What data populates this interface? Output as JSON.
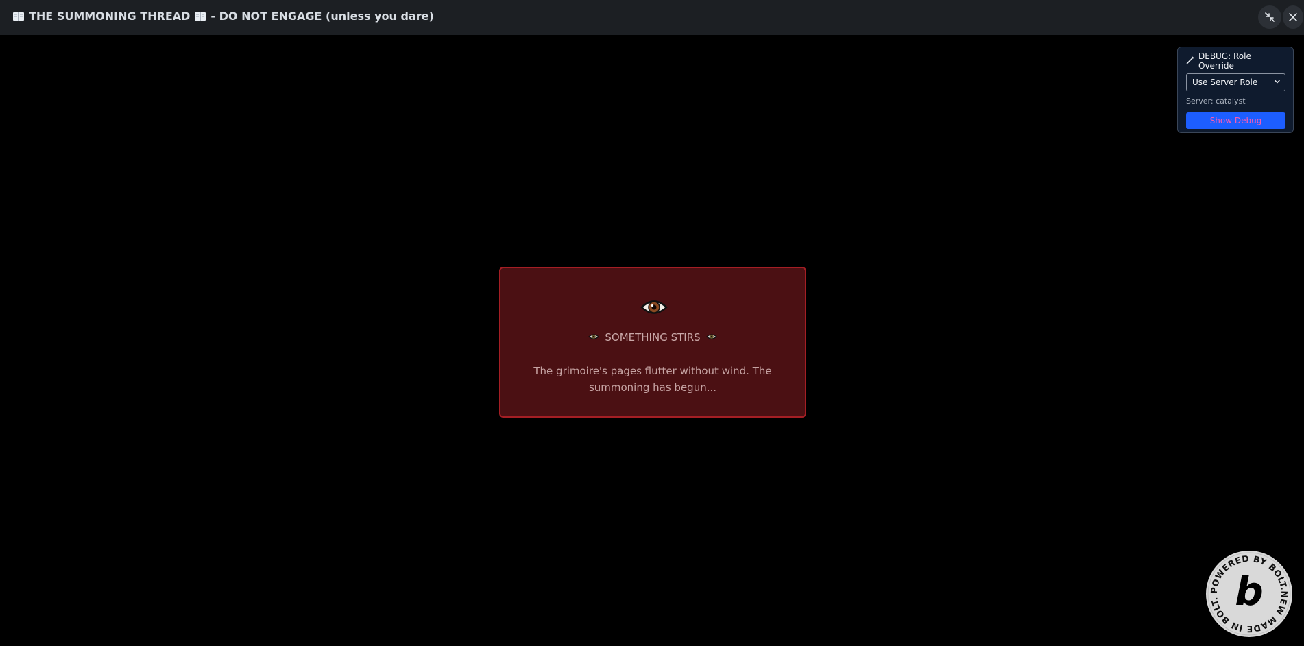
{
  "window": {
    "title_part1": "THE SUMMONING THREAD",
    "title_part2": "- DO NOT ENGAGE (unless you dare)",
    "title_icon": "book-icon",
    "minimize_icon": "minimize-arrows-icon",
    "close_icon": "close-icon"
  },
  "debug": {
    "header": "DEBUG: Role Override",
    "header_icon": "wand-icon",
    "select_value": "Use Server Role",
    "server_text": "Server: catalyst",
    "button_label": "Show Debug"
  },
  "card": {
    "icon": "eye-icon",
    "heading": "SOMETHING STIRS",
    "body": "The grimoire's pages flutter without wind. The summoning has begun..."
  },
  "badge": {
    "text": "POWERED BY BOLT.NEW MADE IN BOLT.NEW",
    "letter": "b"
  },
  "colors": {
    "background": "#000000",
    "titlebar": "#1c1f23",
    "card_bg": "#4b1013",
    "card_border": "#a41e24",
    "debug_bg": "#0f1b2e",
    "debug_button": "#1d5eff",
    "debug_button_text": "#ff5cb0"
  }
}
